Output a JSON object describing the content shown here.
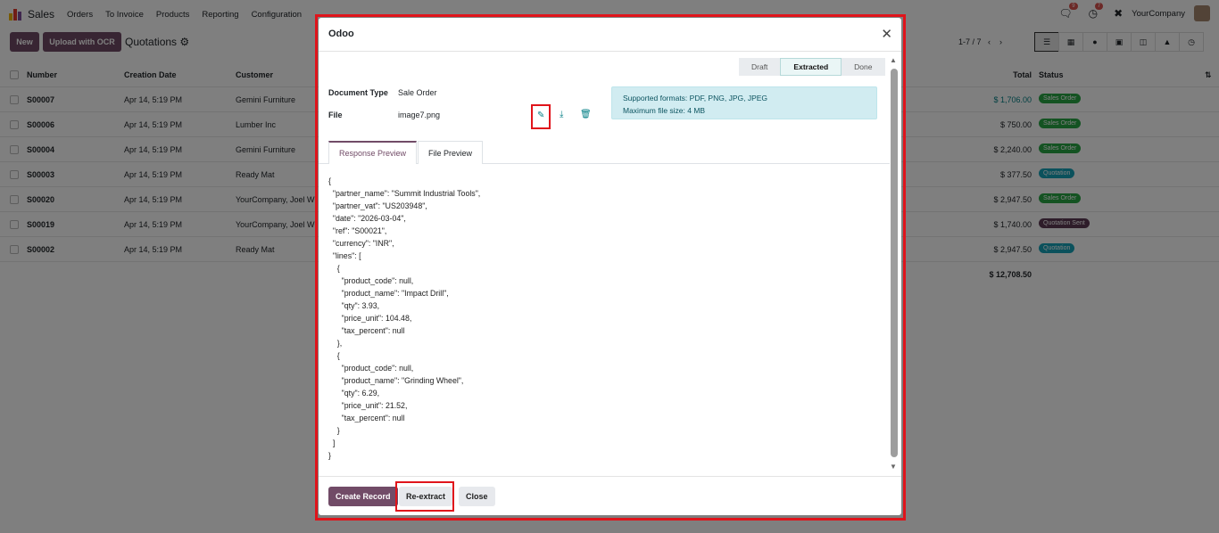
{
  "navbar": {
    "app_name": "Sales",
    "menu": [
      "Orders",
      "To Invoice",
      "Products",
      "Reporting",
      "Configuration"
    ],
    "messages_count": "9",
    "activities_count": "7",
    "company": "YourCompany"
  },
  "control_panel": {
    "new_label": "New",
    "upload_label": "Upload with OCR",
    "title": "Quotations",
    "pager": "1-7 / 7"
  },
  "list": {
    "columns": {
      "number": "Number",
      "creation_date": "Creation Date",
      "customer": "Customer",
      "total": "Total",
      "status": "Status"
    },
    "rows": [
      {
        "number": "S00007",
        "date": "Apr 14, 5:19 PM",
        "customer": "Gemini Furniture",
        "total": "$ 1,706.00",
        "status": "Sales Order"
      },
      {
        "number": "S00006",
        "date": "Apr 14, 5:19 PM",
        "customer": "Lumber Inc",
        "total": "$ 750.00",
        "status": "Sales Order"
      },
      {
        "number": "S00004",
        "date": "Apr 14, 5:19 PM",
        "customer": "Gemini Furniture",
        "total": "$ 2,240.00",
        "status": "Sales Order"
      },
      {
        "number": "S00003",
        "date": "Apr 14, 5:19 PM",
        "customer": "Ready Mat",
        "total": "$ 377.50",
        "status": "Quotation"
      },
      {
        "number": "S00020",
        "date": "Apr 14, 5:19 PM",
        "customer": "YourCompany, Joel Willis",
        "total": "$ 2,947.50",
        "status": "Sales Order"
      },
      {
        "number": "S00019",
        "date": "Apr 14, 5:19 PM",
        "customer": "YourCompany, Joel Willis",
        "total": "$ 1,740.00",
        "status": "Quotation Sent"
      },
      {
        "number": "S00002",
        "date": "Apr 14, 5:19 PM",
        "customer": "Ready Mat",
        "total": "$ 2,947.50",
        "status": "Quotation"
      }
    ],
    "grand_total": "$ 12,708.50"
  },
  "status_colors": {
    "Sales Order": "#28a745",
    "Quotation": "#17a2b8",
    "Quotation Sent": "#5c3a54"
  },
  "modal": {
    "title": "Odoo",
    "status_steps": [
      "Draft",
      "Extracted",
      "Done"
    ],
    "current_step": "Extracted",
    "document_type_label": "Document Type",
    "document_type_value": "Sale Order",
    "file_label": "File",
    "file_value": "image7.png",
    "alert_line1": "Supported formats: PDF, PNG, JPG, JPEG",
    "alert_line2": "Maximum file size: 4 MB",
    "tabs": [
      "Response Preview",
      "File Preview"
    ],
    "response_json": "{\n  \"partner_name\": \"Summit Industrial Tools\",\n  \"partner_vat\": \"US203948\",\n  \"date\": \"2026-03-04\",\n  \"ref\": \"S00021\",\n  \"currency\": \"INR\",\n  \"lines\": [\n    {\n      \"product_code\": null,\n      \"product_name\": \"Impact Drill\",\n      \"qty\": 3.93,\n      \"price_unit\": 104.48,\n      \"tax_percent\": null\n    },\n    {\n      \"product_code\": null,\n      \"product_name\": \"Grinding Wheel\",\n      \"qty\": 6.29,\n      \"price_unit\": 21.52,\n      \"tax_percent\": null\n    }\n  ]\n}",
    "create_record_label": "Create Record",
    "reextract_label": "Re-extract",
    "close_label": "Close"
  },
  "accent_color": "#714b67",
  "highlight_color": "#e0141b"
}
